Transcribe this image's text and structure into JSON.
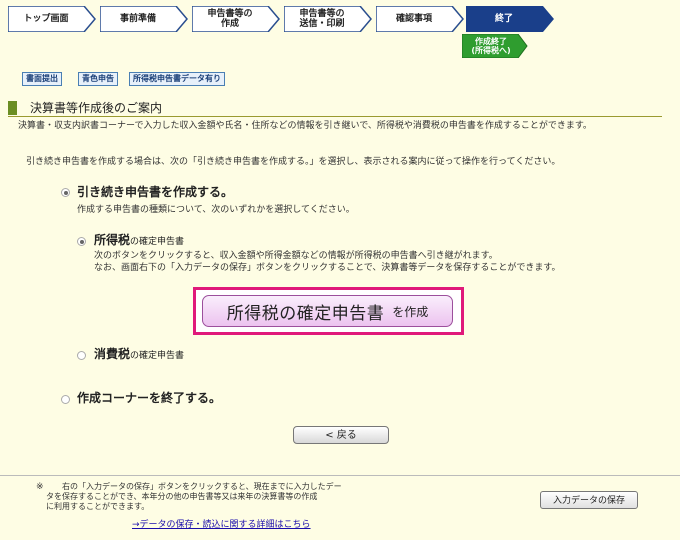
{
  "steps": [
    {
      "label": "トップ画面"
    },
    {
      "label": "事前準備"
    },
    {
      "label": "申告書等の\n作成"
    },
    {
      "label": "申告書等の\n送信・印刷"
    },
    {
      "label": "確認事項"
    },
    {
      "label": "終了"
    }
  ],
  "finish_button": {
    "label": "作成終了\n(所得税へ)"
  },
  "tags": [
    "書面提出",
    "青色申告",
    "所得税申告書データ有り"
  ],
  "section_title": "決算書等作成後のご案内",
  "intro": {
    "line1": "決算書・収支内訳書コーナーで入力した収入金額や氏名・住所などの情報を引き継いで、所得税や消費税の申告書を作成することができます。",
    "line2": "引き続き申告書を作成する場合は、次の「引き続き申告書を作成する。」を選択し、表示される案内に従って操作を行ってください。"
  },
  "option_continue": {
    "label": "引き続き申告書を作成する。",
    "desc": "作成する申告書の種類について、次のいずれかを選択してください。"
  },
  "option_income": {
    "label_bold": "所得税",
    "label_sub": "の確定申告書",
    "desc1": "次のボタンをクリックすると、収入金額や所得金額などの情報が所得税の申告書へ引き継がれます。",
    "desc2": "なお、画面右下の「入力データの保存」ボタンをクリックすることで、決算書等データを保存することができます。"
  },
  "create_button": {
    "big": "所得税の確定申告書",
    "small": "を作成"
  },
  "option_consumption": {
    "label_bold": "消費税",
    "label_sub": "の確定申告書"
  },
  "option_end": {
    "label": "作成コーナーを終了する。"
  },
  "back_button": {
    "label": "< 戻る"
  },
  "footnote": {
    "mark": "※",
    "line1": "右の「入力データの保存」ボタンをクリックすると、現在までに入力したデー",
    "line2": "タを保存することができ、本年分の他の申告書等又は来年の決算書等の作成",
    "line3": "に利用することができます。"
  },
  "save_button": {
    "label": "入力データの保存"
  },
  "detail_link": {
    "label": "→データの保存・読込に関する詳細はこちら"
  },
  "colors": {
    "background": "#fefde4",
    "step_active": "#1a3f8a",
    "finish_green": "#2f9d2f",
    "highlight_border": "#e0197a"
  }
}
